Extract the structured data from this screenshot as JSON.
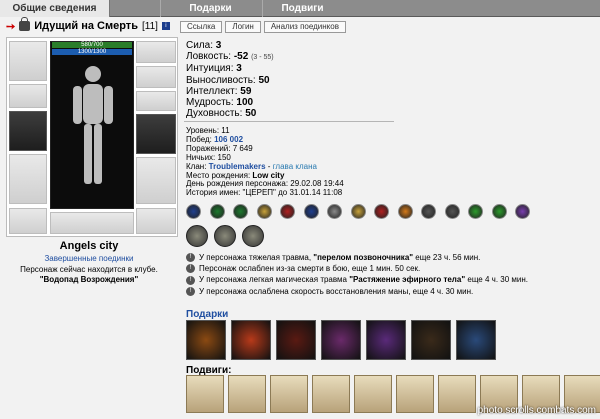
{
  "tabs": [
    {
      "label": "Общие сведения",
      "active": true
    },
    {
      "label": "Подарки",
      "active": false
    },
    {
      "label": "Подвиги",
      "active": false
    }
  ],
  "character": {
    "name": "Идущий на Смерть",
    "level": "[11]",
    "hp": "580/700",
    "mana": "1300/1300"
  },
  "top_buttons": [
    "Ссылка",
    "Логин",
    "Анализ поединков"
  ],
  "guild_name": "Angels city",
  "fights_link": "Завершенные поединки",
  "location": {
    "line1": "Персонаж сейчас находится в клубе.",
    "line2": "\"Водопад Возрождения\""
  },
  "stats": [
    {
      "label": "Сила:",
      "value": "3",
      "extra": ""
    },
    {
      "label": "Ловкость:",
      "value": "-52",
      "extra": "(3 - 55)"
    },
    {
      "label": "Интуиция:",
      "value": "3",
      "extra": ""
    },
    {
      "label": "Выносливость:",
      "value": "50",
      "extra": ""
    },
    {
      "label": "Интеллект:",
      "value": "59",
      "extra": ""
    },
    {
      "label": "Мудрость:",
      "value": "100",
      "extra": ""
    },
    {
      "label": "Духовность:",
      "value": "50",
      "extra": ""
    }
  ],
  "details": {
    "level": "Уровень: 11",
    "wins_label": "Побед:",
    "wins_value": "106 002",
    "losses": "Поражений: 7 649",
    "draws": "Ничьих: 150",
    "clan_label": "Клан:",
    "clan_name": "Troublemakers",
    "clan_sep": " - ",
    "clan_role": "глава клана",
    "birthplace_label": "Место рождения:",
    "birthplace_value": "Low city",
    "birthday": "День рождения персонажа: 29.02.08 19:44",
    "history": "История имен: \"ЦЕРЕП\" до 31.01.14 11:08"
  },
  "badge_colors": [
    "#1f3f8f",
    "#1d7a2e",
    "#1d7a2e",
    "#c8a23a",
    "#b02020",
    "#1f3f8f",
    "#8a8a8a",
    "#c8a23a",
    "#b02020",
    "#d47a1a",
    "#555555",
    "#555555",
    "#2b9c2b",
    "#2b9c2b",
    "#7a3fb0"
  ],
  "effects": [
    {
      "text": "У персонажа тяжелая травма, ",
      "bold": "\"перелом позвоночника\"",
      "tail": " еще 23 ч. 56 мин."
    },
    {
      "text": "Персонаж ослаблен из-за смерти в бою, еще 1 мин. 50 сек.",
      "bold": "",
      "tail": ""
    },
    {
      "text": "У персонажа легкая магическая травма ",
      "bold": "\"Растяжение эфирного тела\"",
      "tail": " еще 4 ч. 30 мин."
    },
    {
      "text": "У персонажа ослаблена скорость восстановления маны, еще 4 ч. 30 мин.",
      "bold": "",
      "tail": ""
    }
  ],
  "gifts_title": "Подарки",
  "gift_colors": [
    "#8b4a12",
    "#b83a1a",
    "#5a1a12",
    "#6a2a6a",
    "#5a2a7a",
    "#3a2a1a",
    "#2a4a7a"
  ],
  "feats_title": "Подвиги:",
  "feat_count": 10,
  "watermark": "photo.scrolls.combats.com"
}
